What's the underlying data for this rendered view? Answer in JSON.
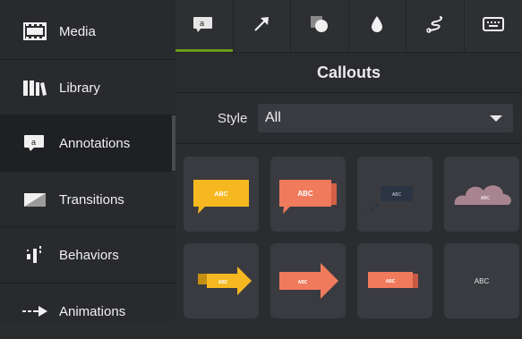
{
  "sidebar": {
    "items": [
      {
        "label": "Media",
        "icon": "film-icon"
      },
      {
        "label": "Library",
        "icon": "books-icon"
      },
      {
        "label": "Annotations",
        "icon": "annotation-icon"
      },
      {
        "label": "Transitions",
        "icon": "transition-icon"
      },
      {
        "label": "Behaviors",
        "icon": "behaviors-icon"
      },
      {
        "label": "Animations",
        "icon": "animation-arrow-icon"
      }
    ],
    "active_index": 2
  },
  "tabs": [
    {
      "icon": "callout-tab-icon",
      "active": true
    },
    {
      "icon": "arrow-tab-icon",
      "active": false
    },
    {
      "icon": "shape-tab-icon",
      "active": false
    },
    {
      "icon": "blur-drop-tab-icon",
      "active": false
    },
    {
      "icon": "sketch-tab-icon",
      "active": false
    },
    {
      "icon": "keyboard-tab-icon",
      "active": false
    }
  ],
  "panel": {
    "title": "Callouts",
    "style_label": "Style",
    "style_value": "All"
  },
  "tiles": [
    {
      "text": "ABC",
      "kind": "yellow-speech"
    },
    {
      "text": "ABC",
      "kind": "orange-speech"
    },
    {
      "text": "ABC",
      "kind": "dark-thought"
    },
    {
      "text": "ABC",
      "kind": "cloud"
    },
    {
      "text": "ABC",
      "kind": "yellow-arrow"
    },
    {
      "text": "ABC",
      "kind": "orange-arrow"
    },
    {
      "text": "ABC",
      "kind": "orange-banner"
    },
    {
      "text": "ABC",
      "kind": "text-only"
    }
  ],
  "colors": {
    "accent": "#6c9a1b",
    "yellow": "#f5b820",
    "orange": "#f07a5c",
    "cloud": "#a7848f",
    "dark_box": "#2b3442"
  }
}
